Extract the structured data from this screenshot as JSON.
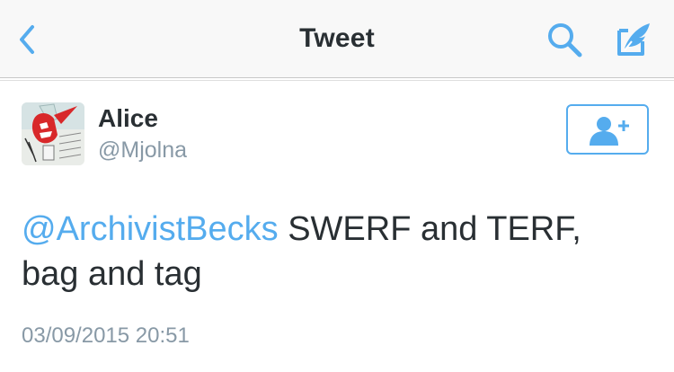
{
  "nav": {
    "title": "Tweet"
  },
  "tweet": {
    "author_name": "Alice",
    "author_handle": "@Mjolna",
    "mention": "@ArchivistBecks",
    "text_line1": " SWERF and TERF,",
    "text_line2": "bag and tag",
    "timestamp": "03/09/2015 20:51"
  },
  "colors": {
    "accent": "#55acee",
    "text": "#292f33",
    "muted": "#8899a6"
  },
  "icons": [
    "back-chevron-icon",
    "search-icon",
    "compose-icon",
    "follow-user-icon"
  ]
}
